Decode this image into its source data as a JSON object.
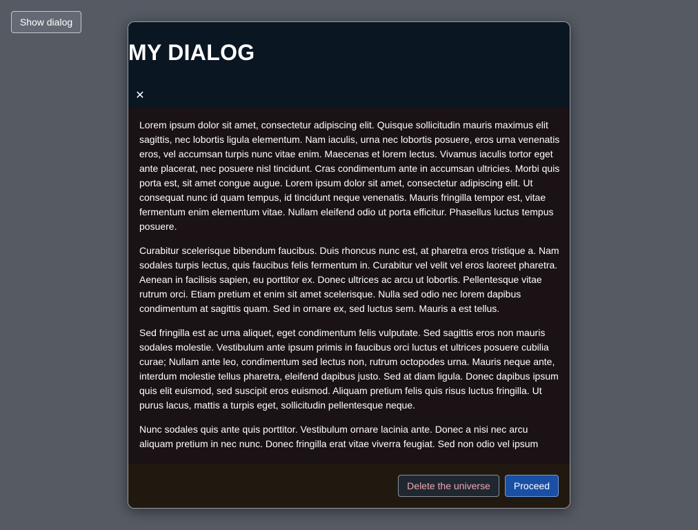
{
  "page": {
    "show_dialog_label": "Show dialog"
  },
  "dialog": {
    "title": "MY DIALOG",
    "close_glyph": "✕",
    "close_icon": "close-icon",
    "paragraphs": [
      "Lorem ipsum dolor sit amet, consectetur adipiscing elit. Quisque sollicitudin mauris maximus elit sagittis, nec lobortis ligula elementum. Nam iaculis, urna nec lobortis posuere, eros urna venenatis eros, vel accumsan turpis nunc vitae enim. Maecenas et lorem lectus. Vivamus iaculis tortor eget ante placerat, nec posuere nisl tincidunt. Cras condimentum ante in accumsan ultricies. Morbi quis porta est, sit amet congue augue. Lorem ipsum dolor sit amet, consectetur adipiscing elit. Ut consequat nunc id quam tempus, id tincidunt neque venenatis. Mauris fringilla tempor est, vitae fermentum enim elementum vitae. Nullam eleifend odio ut porta efficitur. Phasellus luctus tempus posuere.",
      "Curabitur scelerisque bibendum faucibus. Duis rhoncus nunc est, at pharetra eros tristique a. Nam sodales turpis lectus, quis faucibus felis fermentum in. Curabitur vel velit vel eros laoreet pharetra. Aenean in facilisis sapien, eu porttitor ex. Donec ultrices ac arcu ut lobortis. Pellentesque vitae rutrum orci. Etiam pretium et enim sit amet scelerisque. Nulla sed odio nec lorem dapibus condimentum at sagittis quam. Sed in ornare ex, sed luctus sem. Mauris a est tellus.",
      "Sed fringilla est ac urna aliquet, eget condimentum felis vulputate. Sed sagittis eros non mauris sodales molestie. Vestibulum ante ipsum primis in faucibus orci luctus et ultrices posuere cubilia curae; Nullam ante leo, condimentum sed lectus non, rutrum octopodes urna. Mauris neque ante, interdum molestie tellus pharetra, eleifend dapibus justo. Sed at diam ligula. Donec dapibus ipsum quis elit euismod, sed suscipit eros euismod. Aliquam pretium felis quis risus luctus fringilla. Ut purus lacus, mattis a turpis eget, sollicitudin pellentesque neque.",
      "Nunc sodales quis ante quis porttitor. Vestibulum ornare lacinia ante. Donec a nisi nec arcu aliquam pretium in nec nunc. Donec fringilla erat vitae viverra feugiat. Sed non odio vel ipsum"
    ],
    "footer": {
      "delete_label": "Delete the universe",
      "proceed_label": "Proceed"
    }
  },
  "colors": {
    "backdrop": "#555a63",
    "header_bg": "#0a1622",
    "body_bg": "#1b1216",
    "footer_bg": "#21190f",
    "danger_text": "#f0a6b2",
    "primary": "#1a4fa6"
  }
}
